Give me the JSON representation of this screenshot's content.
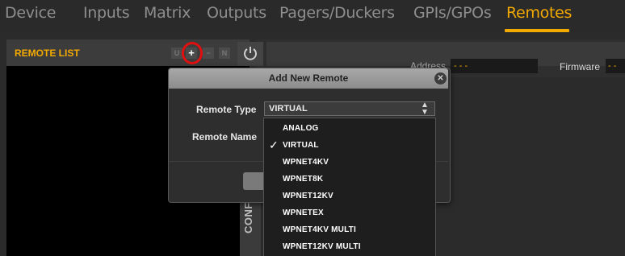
{
  "nav": {
    "tabs": [
      {
        "label": "Device"
      },
      {
        "label": "Inputs"
      },
      {
        "label": "Matrix"
      },
      {
        "label": "Outputs"
      },
      {
        "label": "Pagers/Duckers"
      },
      {
        "label": "GPIs/GPOs"
      },
      {
        "label": "Remotes"
      }
    ],
    "active_tab": "Remotes",
    "accent_color": "#f2a900"
  },
  "remote_list": {
    "title": "REMOTE LIST",
    "buttons": {
      "u": "U",
      "add": "+",
      "remove": "−",
      "n": "N"
    }
  },
  "remote_details": {
    "address_label": "Address",
    "address_value": "- - -",
    "firmware_label": "Firmware",
    "firmware_value": "- -",
    "config_label": "CONFI"
  },
  "dialog": {
    "title": "Add New Remote",
    "close_icon": "✕",
    "remote_type_label": "Remote Type",
    "remote_type_value": "VIRTUAL",
    "remote_name_label": "Remote Name",
    "options": [
      "ANALOG",
      "VIRTUAL",
      "WPNET4KV",
      "WPNET8K",
      "WPNET12KV",
      "WPNETEX",
      "WPNET4KV MULTI",
      "WPNET12KV MULTI"
    ],
    "selected_option": "VIRTUAL",
    "check_mark": "✓"
  }
}
